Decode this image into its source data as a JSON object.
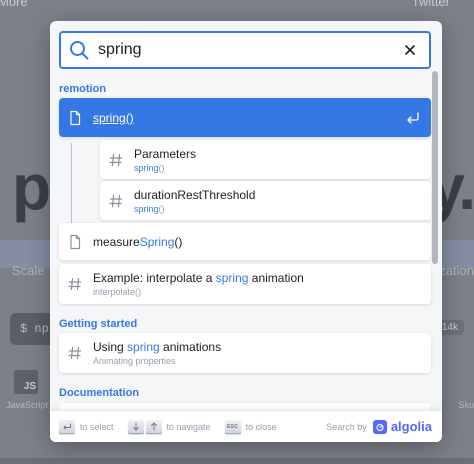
{
  "background": {
    "top_left": "More",
    "top_right": "Twitter",
    "hero_left": "p",
    "hero_right": "y.",
    "subtitle_left": "Scale",
    "subtitle_right": "ization",
    "command_prefix": "$ np",
    "badge": "14k",
    "js_icon": "JS",
    "js_label": "JavaScript",
    "right_label": "Sku"
  },
  "search": {
    "value": "spring",
    "icon": "search-icon",
    "clear_icon": "close-icon"
  },
  "sections": [
    {
      "title": "remotion",
      "hits": [
        {
          "pre": "",
          "match": "spring",
          "post": "()",
          "sub": "",
          "icon": "page-icon",
          "active": true
        },
        {
          "title": "Parameters",
          "sub_match": "spring",
          "sub_post": "()",
          "icon": "hash-icon"
        },
        {
          "title": "durationRestThreshold",
          "sub_match": "spring",
          "sub_post": "()",
          "icon": "hash-icon"
        },
        {
          "pre": "measure",
          "match": "Spring",
          "post": "()",
          "icon": "page-icon"
        },
        {
          "pre": "Example: interpolate a ",
          "match": "spring",
          "post": " animation",
          "sub": "interpolate()",
          "icon": "hash-icon"
        }
      ]
    },
    {
      "title": "Getting started",
      "hits": [
        {
          "pre": "Using ",
          "match": "spring",
          "post": " animations",
          "sub": "Animating properties",
          "icon": "hash-icon"
        }
      ]
    },
    {
      "title": "Documentation",
      "hits": []
    }
  ],
  "footer": {
    "select_label": "to select",
    "navigate_label": "to navigate",
    "close_label": "to close",
    "esc_key": "ESC",
    "search_by": "Search by",
    "brand": "algolia"
  },
  "colors": {
    "accent": "#3578e5",
    "algolia": "#5468ff",
    "muted": "#969faf"
  }
}
